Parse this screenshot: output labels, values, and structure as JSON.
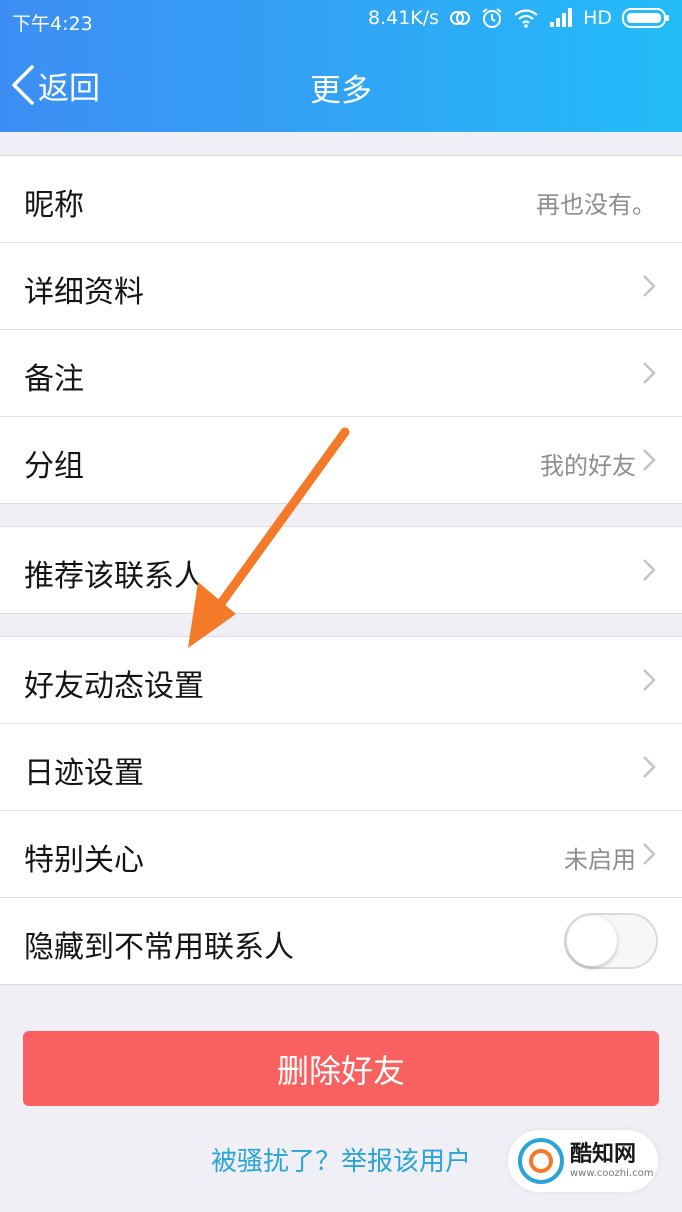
{
  "status_bar": {
    "time": "下午4:23",
    "speed": "8.41K/s",
    "network": "HD"
  },
  "nav": {
    "back_label": "返回",
    "title": "更多"
  },
  "groups": [
    {
      "rows": [
        {
          "label": "昵称",
          "value": "再也没有。",
          "chevron": false
        },
        {
          "label": "详细资料",
          "value": "",
          "chevron": true
        },
        {
          "label": "备注",
          "value": "",
          "chevron": true
        },
        {
          "label": "分组",
          "value": "我的好友",
          "chevron": true
        }
      ]
    },
    {
      "rows": [
        {
          "label": "推荐该联系人",
          "value": "",
          "chevron": true
        }
      ]
    },
    {
      "rows": [
        {
          "label": "好友动态设置",
          "value": "",
          "chevron": true
        },
        {
          "label": "日迹设置",
          "value": "",
          "chevron": true
        },
        {
          "label": "特别关心",
          "value": "未启用",
          "chevron": true
        },
        {
          "label": "隐藏到不常用联系人",
          "value": "",
          "chevron": false,
          "toggle": "off"
        }
      ]
    }
  ],
  "delete_button": "删除好友",
  "report_link": "被骚扰了？举报该用户",
  "watermark": {
    "name": "酷知网",
    "url": "www.coozhi.com"
  },
  "colors": {
    "header_start": "#3d8ef4",
    "header_end": "#22bdf8",
    "delete_bg": "#f86160",
    "link": "#2aa4d8",
    "annotation_arrow": "#f47a2a"
  }
}
